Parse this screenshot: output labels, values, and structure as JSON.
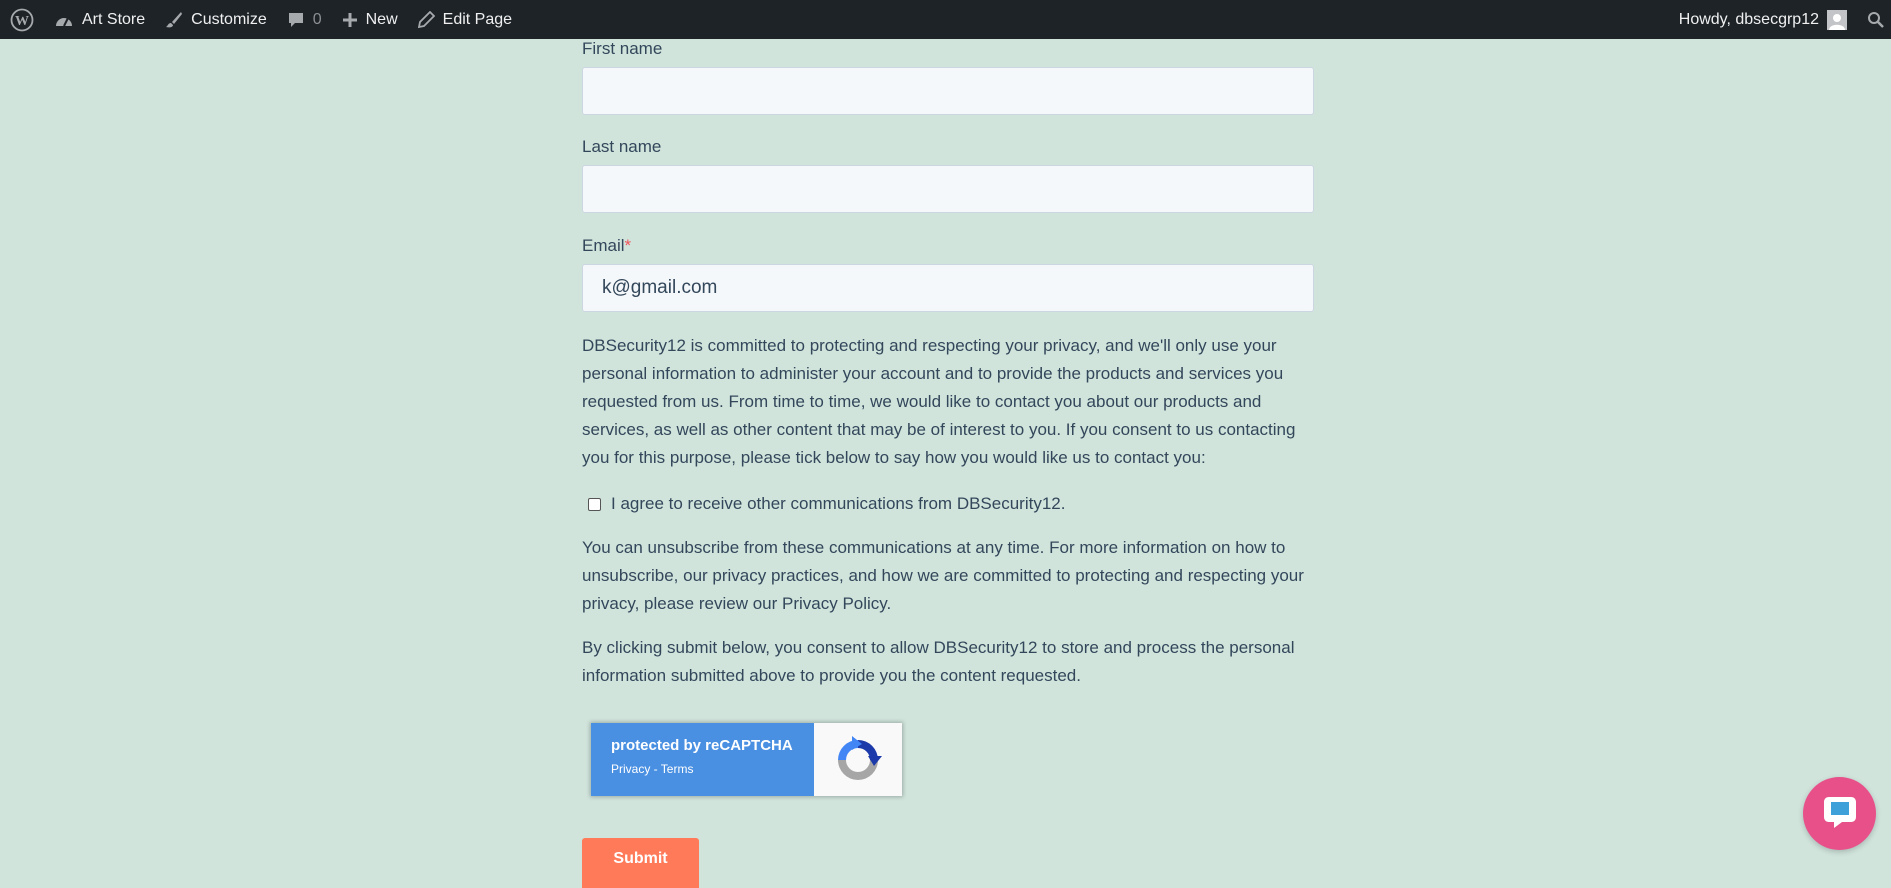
{
  "adminbar": {
    "site_name": "Art Store",
    "customize": "Customize",
    "comments_count": "0",
    "new": "New",
    "edit_page": "Edit Page",
    "howdy": "Howdy, dbsecgrp12"
  },
  "form": {
    "first_name_label": "First name",
    "first_name_value": "",
    "last_name_label": "Last name",
    "last_name_value": "",
    "email_label": "Email",
    "email_required_mark": "*",
    "email_value": "k@gmail.com",
    "privacy_text": "DBSecurity12 is committed to protecting and respecting your privacy, and we'll only use your personal information to administer your account and to provide the products and services you requested from us. From time to time, we would like to contact you about our products and services, as well as other content that may be of interest to you. If you consent to us contacting you for this purpose, please tick below to say how you would like us to contact you:",
    "consent_label": "I agree to receive other communications from DBSecurity12.",
    "unsubscribe_text": "You can unsubscribe from these communications at any time. For more information on how to unsubscribe, our privacy practices, and how we are committed to protecting and respecting your privacy, please review our Privacy Policy.",
    "submit_consent_text": "By clicking submit below, you consent to allow DBSecurity12 to store and process the personal information submitted above to provide you the content requested.",
    "recaptcha_title": "protected by reCAPTCHA",
    "recaptcha_links": "Privacy - Terms",
    "submit_label": "Submit"
  },
  "colors": {
    "background": "#d0e4dc",
    "adminbar": "#1d2327",
    "submit": "#ff7a59",
    "recaptcha": "#4a90e2",
    "chat": "#e8508a"
  }
}
